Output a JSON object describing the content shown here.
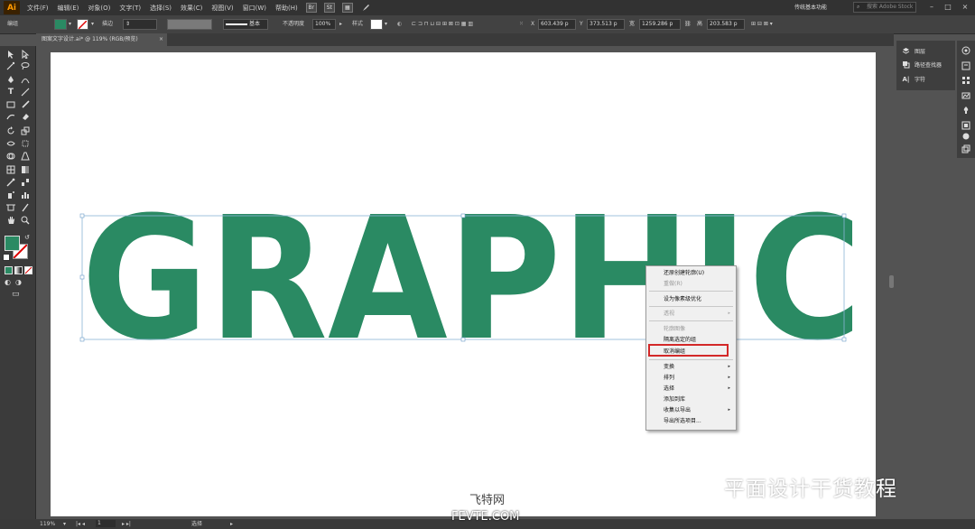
{
  "app": {
    "logo": "Ai"
  },
  "menubar": {
    "items": [
      "文件(F)",
      "编辑(E)",
      "对象(O)",
      "文字(T)",
      "选择(S)",
      "效果(C)",
      "视图(V)",
      "窗口(W)",
      "帮助(H)"
    ],
    "bridge_label": "Br",
    "stock_label": "St",
    "workspace": "传统基本功能",
    "search_placeholder": "搜索 Adobe Stock"
  },
  "controlbar": {
    "selection_label": "编组",
    "stroke_label": "描边",
    "stroke_style": "基本",
    "opacity_label": "不透明度",
    "opacity_value": "100%",
    "style_label": "样式",
    "x_label": "X",
    "x_value": "603.439 p",
    "y_label": "Y",
    "y_value": "373.513 p",
    "w_label": "宽",
    "w_value": "1259.286 p",
    "h_label": "高",
    "h_value": "203.583 p"
  },
  "document": {
    "tab_title": "图案文字设计.ai* @ 119% (RGB/预览)",
    "close": "×",
    "artwork_text": "GRAPHIC",
    "artwork_color": "#2a8a63"
  },
  "panels": {
    "items": [
      "图层",
      "路径查找器",
      "字符"
    ]
  },
  "context_menu": {
    "items": [
      {
        "label": "还原创建轮廓(U)",
        "disabled": false,
        "submenu": false
      },
      {
        "label": "重做(R)",
        "disabled": true,
        "submenu": false
      },
      {
        "label": "设为像素级优化",
        "disabled": false,
        "submenu": false
      },
      {
        "label": "透视",
        "disabled": true,
        "submenu": true
      },
      {
        "label": "轮廓图像",
        "disabled": true,
        "submenu": false
      },
      {
        "label": "隔离选定的组",
        "disabled": false,
        "submenu": false
      },
      {
        "label": "取消编组",
        "disabled": false,
        "submenu": false
      },
      {
        "label": "变换",
        "disabled": false,
        "submenu": true
      },
      {
        "label": "排列",
        "disabled": false,
        "submenu": true
      },
      {
        "label": "选择",
        "disabled": false,
        "submenu": true
      },
      {
        "label": "添加到库",
        "disabled": false,
        "submenu": false
      },
      {
        "label": "收集以导出",
        "disabled": false,
        "submenu": true
      },
      {
        "label": "导出所选项目...",
        "disabled": false,
        "submenu": false
      }
    ],
    "submenu_arrow": "▸",
    "highlight_color": "#d32828"
  },
  "statusbar": {
    "zoom": "119%",
    "artboard_number": "1",
    "status_text": "选择"
  },
  "watermark": {
    "brand": "平面设计干货教程",
    "site_name": "飞特网",
    "site_url": "FEVTE.COM"
  },
  "colors": {
    "fill_swatch": "#2a8a63",
    "accent_logo": "#ff9a00"
  }
}
